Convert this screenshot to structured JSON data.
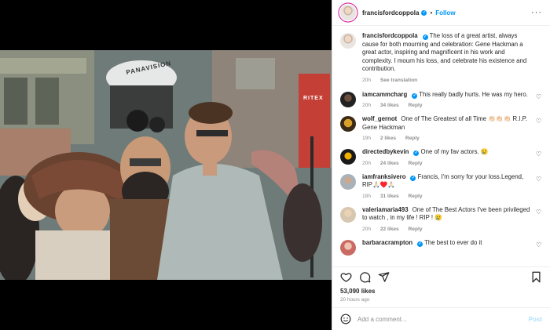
{
  "header": {
    "username": "francisfordcoppola",
    "follow_label": "Follow",
    "more_icon": "more-horizontal-icon"
  },
  "caption": {
    "username": "francisfordcoppola",
    "text": "The loss of a great artist, always cause for both mourning and celebration: Gene Hackman a great actor, inspiring and magnificent in his work and complexity. I mourn his loss, and celebrate his existence and contribution.",
    "time": "20h",
    "see_translation": "See translation"
  },
  "photo": {
    "sign_camera": "PANAVISION",
    "sign_shop": "RITEX"
  },
  "comments": [
    {
      "username": "iamcammcharg",
      "text": "This really badly hurts. He was my hero.",
      "time": "20h",
      "likes": "34 likes",
      "reply": "Reply"
    },
    {
      "username": "wolf_gernot",
      "text": "One of The Greatest of all Time 👏🏻👏🏻👏🏻 R.I.P. Gene Hackman",
      "time": "19h",
      "likes": "2 likes",
      "reply": "Reply"
    },
    {
      "username": "directedbykevin",
      "text": "One of my fav actors. 😢",
      "time": "20h",
      "likes": "24 likes",
      "reply": "Reply"
    },
    {
      "username": "iamfranksivero",
      "text": "Francis, I'm sorry for your loss.Legend, RIP🙏🏻♥️🙏🏻",
      "time": "18h",
      "likes": "31 likes",
      "reply": "Reply"
    },
    {
      "username": "valeriamaria493",
      "text": "One of The Best Actors I've been privileged to watch , in my life ! RIP ! 😢",
      "time": "20h",
      "likes": "22 likes",
      "reply": "Reply"
    },
    {
      "username": "barbaracrampton",
      "text": "The best to ever do it",
      "time": "",
      "likes": "",
      "reply": ""
    }
  ],
  "actions": {
    "like_icon": "heart-icon",
    "comment_icon": "comment-icon",
    "share_icon": "share-icon",
    "save_icon": "bookmark-icon"
  },
  "likes": "53,090 likes",
  "posted": "20 hours ago",
  "add_comment": {
    "placeholder": "Add a comment...",
    "post_label": "Post"
  },
  "colors": {
    "accent": "#0095f6",
    "post_disabled": "#b2dffc",
    "muted": "#8e8e8e"
  }
}
